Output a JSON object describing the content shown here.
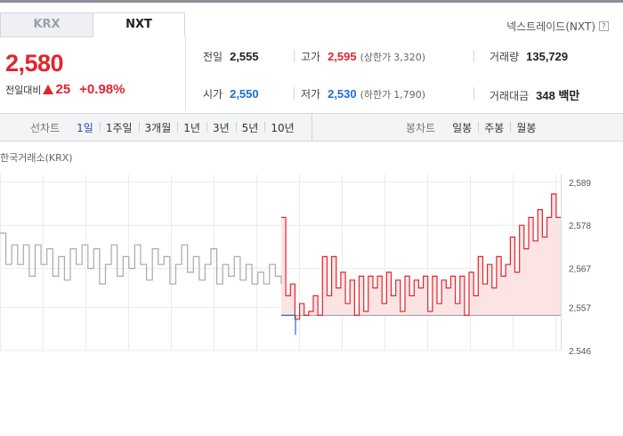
{
  "market_tabs": [
    {
      "label": "KRX",
      "active": false
    },
    {
      "label": "NXT",
      "active": true
    }
  ],
  "exchange_name": "넥스트레이드(NXT)",
  "price": {
    "current": "2,580",
    "change_label": "전일대비",
    "change_direction": "up",
    "change_amount": "25",
    "change_percent": "+0.98%"
  },
  "stats": {
    "prev_close": {
      "label": "전일",
      "value": "2,555"
    },
    "high": {
      "label": "고가",
      "value": "2,595",
      "limit_label": "(상한가",
      "limit_value": "3,320)"
    },
    "volume": {
      "label": "거래량",
      "value": "135,729"
    },
    "open": {
      "label": "시가",
      "value": "2,550"
    },
    "low": {
      "label": "저가",
      "value": "2,530",
      "limit_label": "(하한가",
      "limit_value": "1,790)"
    },
    "trade_amount": {
      "label": "거래대금",
      "value": "348 백만"
    }
  },
  "line_chart_tabs": {
    "title": "선차트",
    "items": [
      "1일",
      "1주일",
      "3개월",
      "1년",
      "3년",
      "5년",
      "10년"
    ],
    "selected": "1일"
  },
  "candle_chart_tabs": {
    "title": "봉차트",
    "items": [
      "일봉",
      "주봉",
      "월봉"
    ]
  },
  "chart_caption": "한국거래소(KRX)",
  "colors": {
    "up": "#e1252e",
    "down": "#1e6fd0",
    "krx_line": "#a9a9a9",
    "nxt_fill": "#fde4e4",
    "selected_tab": "#1e4fb8"
  },
  "chart_data": {
    "type": "line",
    "ylim": [
      2546,
      2591
    ],
    "y_ticks": [
      "2,589",
      "2,578",
      "2,567",
      "2,557",
      "2,546"
    ],
    "y_tick_values": [
      2589,
      2578,
      2567,
      2557,
      2546
    ],
    "baseline": 2555,
    "series": [
      {
        "values": [
          2576,
          2568,
          2573,
          2568,
          2573,
          2565,
          2573,
          2568,
          2572,
          2565,
          2570,
          2564,
          2572,
          2568,
          2573,
          2567,
          2572,
          2563,
          2568,
          2573,
          2565,
          2570,
          2567,
          2573,
          2568,
          2564,
          2572,
          2568,
          2570,
          2563,
          2568,
          2573,
          2566,
          2570,
          2564,
          2568,
          2572,
          2563,
          2568,
          2565,
          2570,
          2564,
          2568,
          2563,
          2566,
          2563,
          2568,
          2565,
          2563
        ]
      },
      {
        "values": [
          2580,
          2560,
          2563,
          2554,
          2558,
          2555,
          2556,
          2560,
          2555,
          2570,
          2560,
          2570,
          2562,
          2566,
          2558,
          2564,
          2555,
          2565,
          2556,
          2565,
          2562,
          2565,
          2558,
          2566,
          2560,
          2564,
          2556,
          2565,
          2560,
          2564,
          2562,
          2565,
          2556,
          2565,
          2558,
          2564,
          2562,
          2565,
          2558,
          2565,
          2555,
          2566,
          2560,
          2570,
          2563,
          2568,
          2562,
          2570,
          2565,
          2568,
          2575,
          2566,
          2578,
          2572,
          2580,
          2574,
          2582,
          2575,
          2580,
          2586,
          2580,
          2580
        ]
      },
      {
        "values": [
          2555,
          2550
        ]
      }
    ]
  }
}
